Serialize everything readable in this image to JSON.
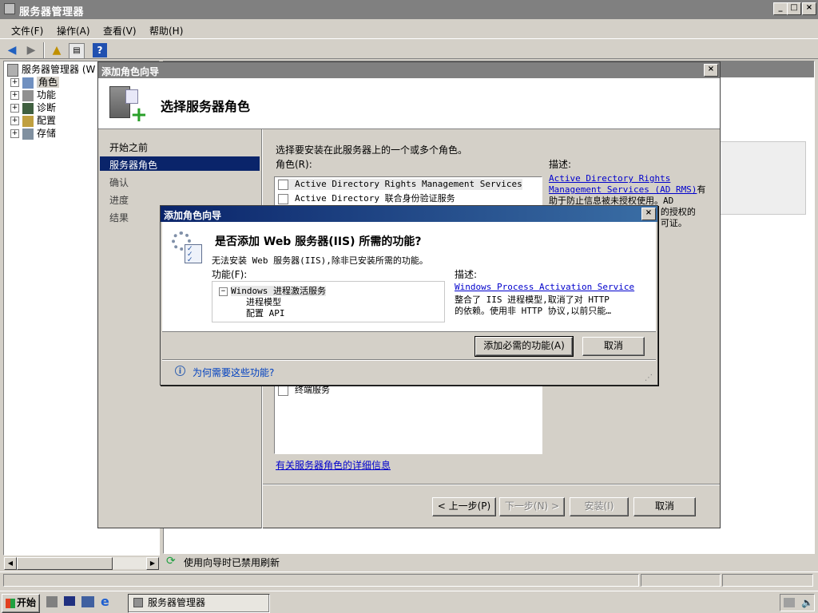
{
  "main_window": {
    "title": "服务器管理器",
    "menu": [
      "文件(F)",
      "操作(A)",
      "查看(V)",
      "帮助(H)"
    ]
  },
  "tree": {
    "root": "服务器管理器 (W",
    "items": [
      "角色",
      "功能",
      "诊断",
      "配置",
      "存储"
    ]
  },
  "status_bar": {
    "message": "使用向导时已禁用刷新"
  },
  "wizard": {
    "title": "添加角色向导",
    "header": "选择服务器角色",
    "nav": [
      "开始之前",
      "服务器角色",
      "确认",
      "进度",
      "结果"
    ],
    "nav_selected": "服务器角色",
    "instruction": "选择要安装在此服务器上的一个或多个角色。",
    "roles_label": "角色(R):",
    "roles": [
      "Active Directory Rights Management Services",
      "Active Directory 联合身份验证服务",
      "终端服务"
    ],
    "desc_label": "描述:",
    "desc_link": "Active Directory Rights Management Services (AD RMS)",
    "desc_link_line1": "Active Directory Rights",
    "desc_link_line2": "Management Services (AD RMS)",
    "desc_tail": "有",
    "desc_line3": "助于防止信息被未授权使用。AD",
    "desc_line4": "...的授权的",
    "desc_line5": "...可证。",
    "more_info": "有关服务器角色的详细信息",
    "buttons": {
      "back": "< 上一步(P)",
      "next": "下一步(N) >",
      "install": "安装(I)",
      "cancel": "取消"
    }
  },
  "dialog": {
    "title": "添加角色向导",
    "heading": "是否添加 Web 服务器(IIS) 所需的功能?",
    "subtext": "无法安装 Web 服务器(IIS),除非已安装所需的功能。",
    "features_label": "功能(F):",
    "features_root": "Windows 进程激活服务",
    "features_children": [
      "进程模型",
      "配置 API"
    ],
    "desc_label": "描述:",
    "desc_link": "Windows Process Activation Service",
    "desc_line1": "整合了 IIS 进程模型,取消了对 HTTP",
    "desc_line2": "的依赖。使用非 HTTP 协议,以前只能…",
    "add_button": "添加必需的功能(A)",
    "cancel_button": "取消",
    "help_link": "为何需要这些功能?"
  },
  "taskbar": {
    "start": "开始",
    "task": "服务器管理器"
  }
}
